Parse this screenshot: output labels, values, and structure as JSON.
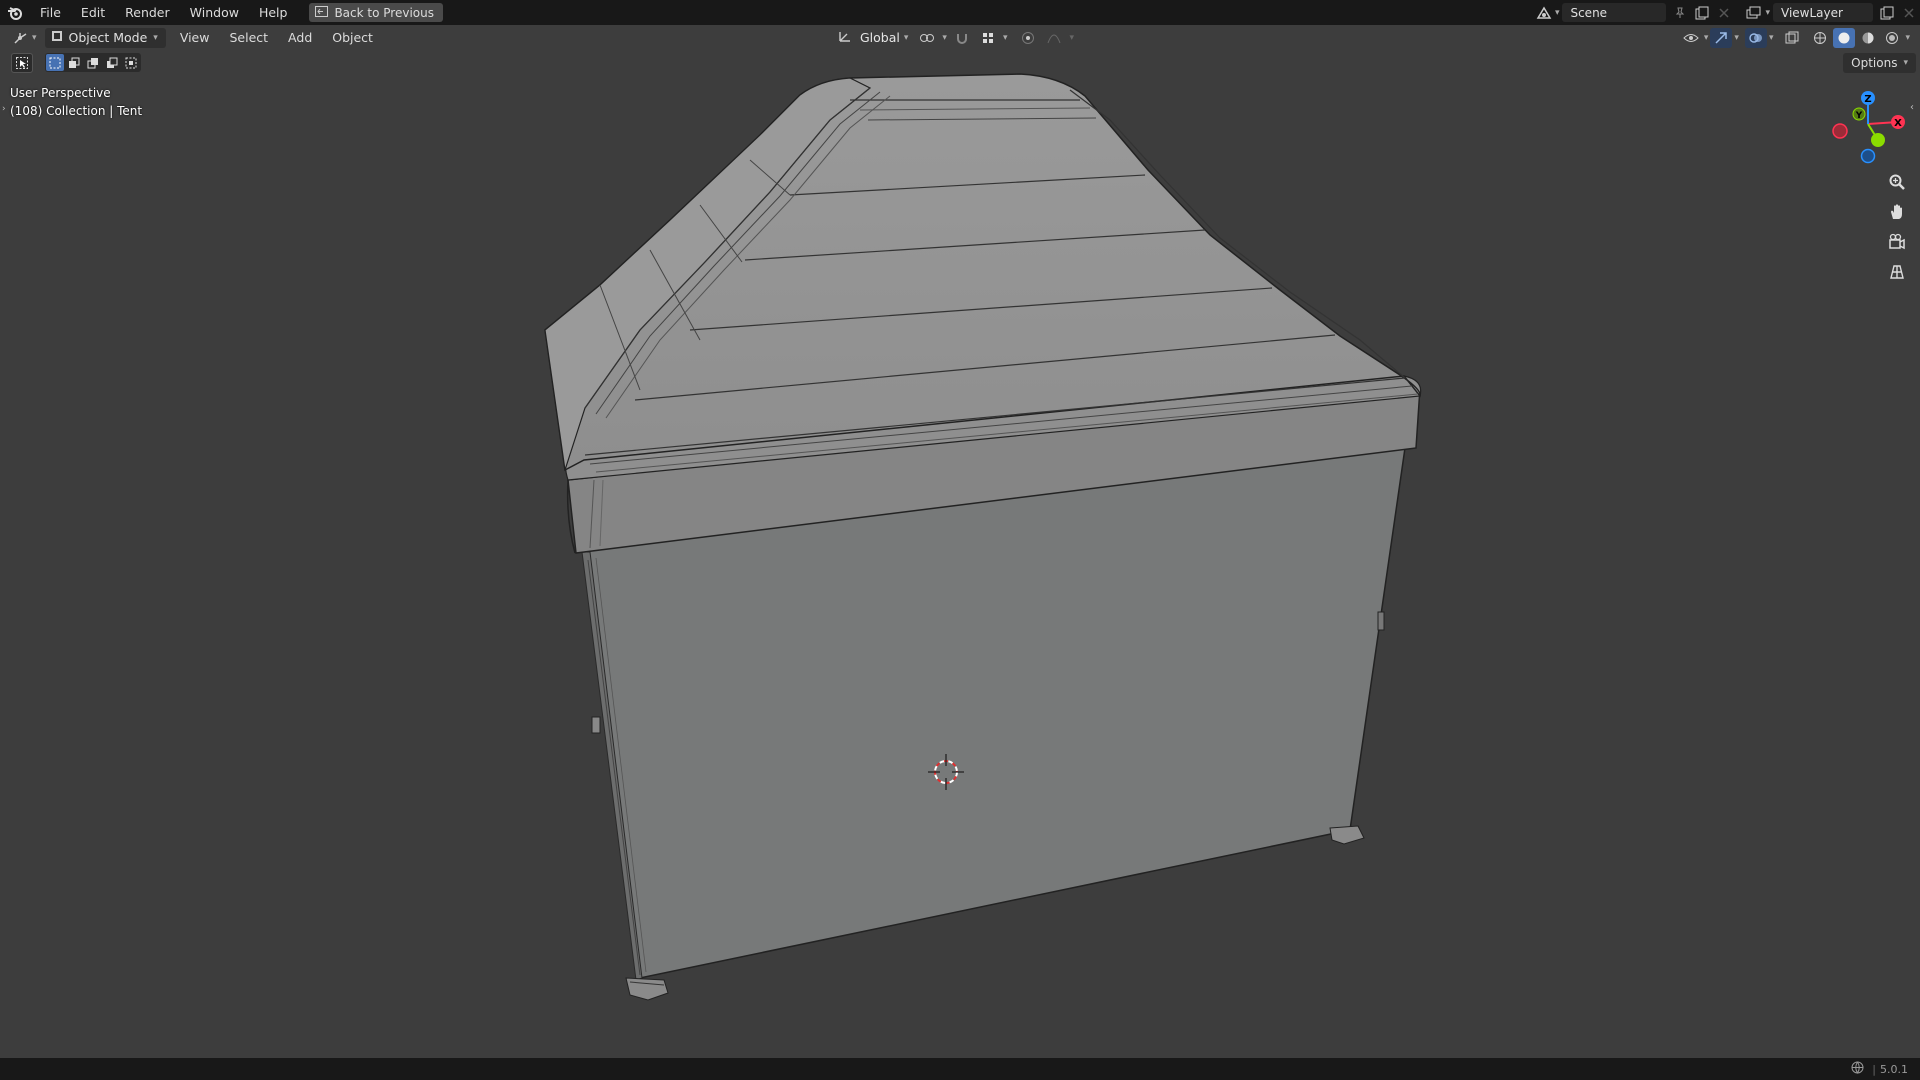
{
  "topbar": {
    "menus": [
      "File",
      "Edit",
      "Render",
      "Window",
      "Help"
    ],
    "back_label": "Back to Previous",
    "scene_name": "Scene",
    "view_layer": "ViewLayer"
  },
  "header": {
    "mode": "Object Mode",
    "menus": [
      "View",
      "Select",
      "Add",
      "Object"
    ],
    "orientation": "Global",
    "options_label": "Options"
  },
  "viewport": {
    "perspective_label": "User Perspective",
    "collection_label": "(108) Collection | Tent"
  },
  "gizmo": {
    "x": "X",
    "y": "Y",
    "z": "Z"
  },
  "status": {
    "version": "5.0.1"
  },
  "colors": {
    "accent": "#4772b3",
    "axis_x": "#ff3352",
    "axis_y": "#8bdc00",
    "axis_z": "#2890ff"
  }
}
